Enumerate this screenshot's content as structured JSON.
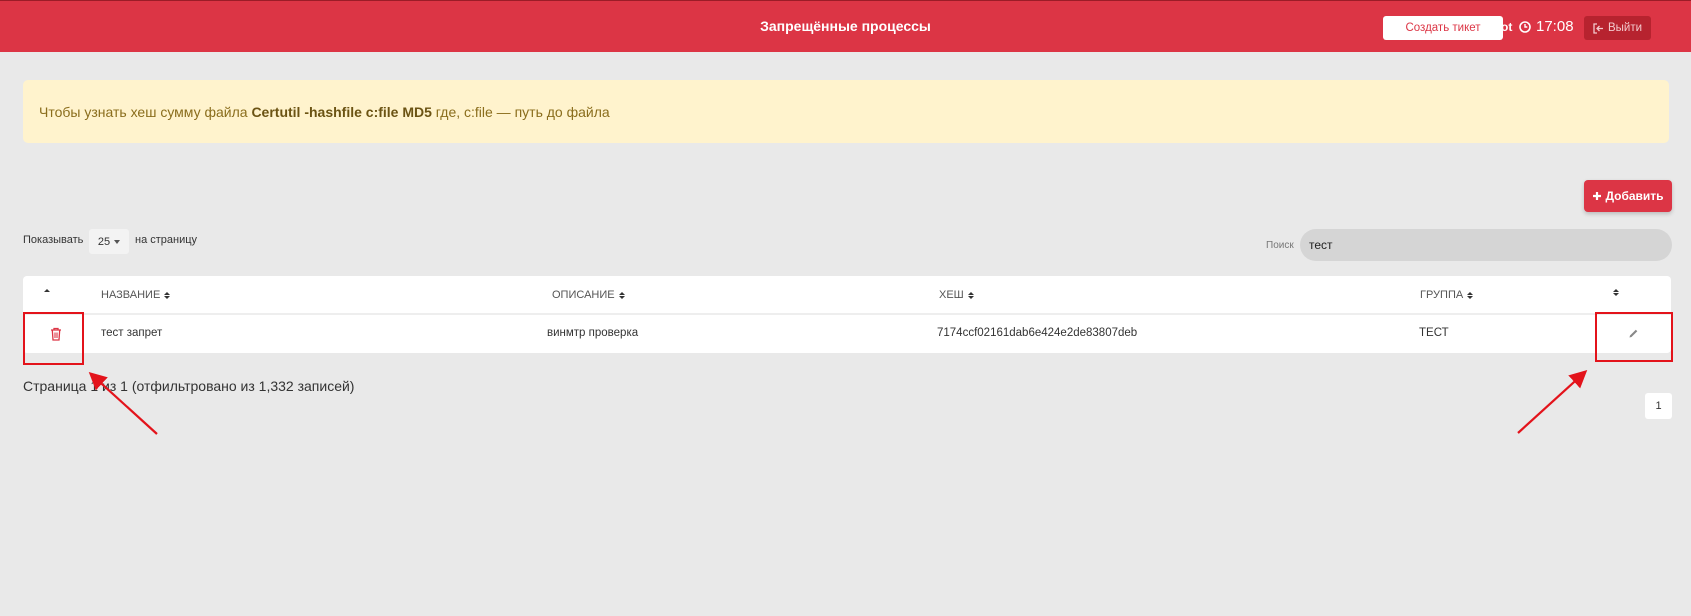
{
  "header": {
    "title": "Запрещённые процессы",
    "create_ticket_label": "Создать тикет",
    "user": "Root",
    "time": "17:08",
    "logout_label": "Выйти",
    "accent_color": "#dc3545"
  },
  "alert": {
    "prefix": "Чтобы узнать хеш сумму файла ",
    "command": "Certutil -hashfile c:file MD5",
    "suffix": " где, c:file — путь до файла"
  },
  "toolbar": {
    "add_label": "Добавить",
    "show_label": "Показывать",
    "page_length": "25",
    "per_page_label": "на страницу",
    "search_label": "Поиск",
    "search_value": "тест"
  },
  "table": {
    "columns": [
      "НАЗВАНИЕ",
      "ОПИСАНИЕ",
      "ХЕШ",
      "ГРУППА"
    ],
    "rows": [
      {
        "name": "тест запрет",
        "description": "винмтр проверка",
        "hash": "7174ccf02161dab6e424e2de83807deb",
        "group": "ТЕСТ"
      }
    ]
  },
  "footer": {
    "info": "Страница 1 из 1 (отфильтровано из 1,332 записей)",
    "current_page": "1"
  },
  "icons": {
    "delete": "trash-icon",
    "edit": "pencil-icon",
    "clock": "clock-icon",
    "logout": "logout-icon",
    "add": "plus-icon"
  }
}
